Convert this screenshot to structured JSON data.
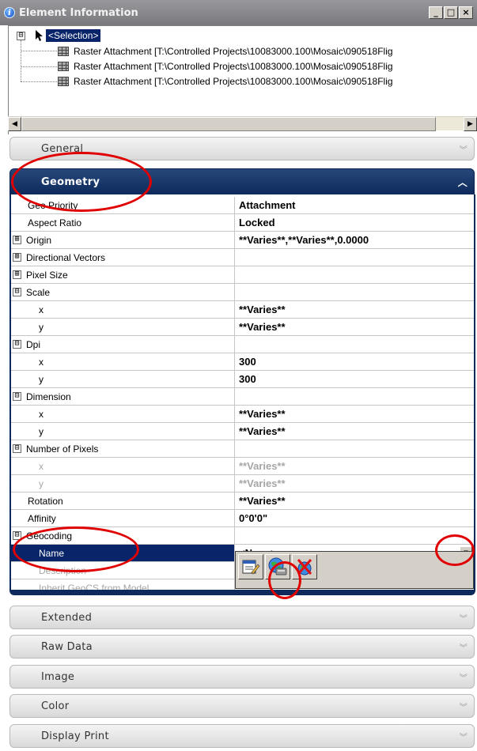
{
  "window": {
    "title": "Element Information",
    "buttons": {
      "minimize": "_",
      "maximize": "□",
      "close": "×"
    }
  },
  "tree": {
    "root": {
      "expander": "⊟",
      "label": "<Selection>"
    },
    "children": [
      {
        "label": "Raster Attachment [T:\\Controlled Projects\\10083000.100\\Mosaic\\090518Flig"
      },
      {
        "label": "Raster Attachment [T:\\Controlled Projects\\10083000.100\\Mosaic\\090518Flig"
      },
      {
        "label": "Raster Attachment [T:\\Controlled Projects\\10083000.100\\Mosaic\\090518Flig"
      }
    ],
    "scroll_left": "◀",
    "scroll_right": "▶"
  },
  "sections": {
    "general": {
      "label": "General",
      "chevron": "︾"
    },
    "geometry": {
      "label": "Geometry",
      "chevron": "︿"
    },
    "extended": {
      "label": "Extended",
      "chevron": "︾"
    },
    "raw_data": {
      "label": "Raw Data",
      "chevron": "︾"
    },
    "image": {
      "label": "Image",
      "chevron": "︾"
    },
    "color": {
      "label": "Color",
      "chevron": "︾"
    },
    "display_print": {
      "label": "Display Print",
      "chevron": "︾"
    }
  },
  "geometry_grid": {
    "rows": [
      {
        "name": "Geo Priority",
        "value": "Attachment"
      },
      {
        "name": "Aspect Ratio",
        "value": "Locked"
      },
      {
        "name": "Origin",
        "value": "**Varies**,**Varies**,0.0000",
        "expander": "⊞"
      },
      {
        "name": "Directional Vectors",
        "value": "",
        "expander": "⊞"
      },
      {
        "name": "Pixel Size",
        "value": "",
        "expander": "⊞"
      },
      {
        "name": "Scale",
        "value": "",
        "expander": "⊟"
      },
      {
        "name": "x",
        "value": "**Varies**"
      },
      {
        "name": "y",
        "value": "**Varies**"
      },
      {
        "name": "Dpi",
        "value": "",
        "expander": "⊟"
      },
      {
        "name": "x",
        "value": "300"
      },
      {
        "name": "y",
        "value": "300"
      },
      {
        "name": "Dimension",
        "value": "",
        "expander": "⊟"
      },
      {
        "name": "x",
        "value": "**Varies**"
      },
      {
        "name": "y",
        "value": "**Varies**"
      },
      {
        "name": "Number of Pixels",
        "value": "",
        "expander": "⊟"
      },
      {
        "name": "x",
        "value": "**Varies**"
      },
      {
        "name": "y",
        "value": "**Varies**"
      },
      {
        "name": "Rotation",
        "value": "**Varies**"
      },
      {
        "name": "Affinity",
        "value": "0°0'0\""
      },
      {
        "name": "Geocoding",
        "value": "",
        "expander": "⊟"
      },
      {
        "name": "Name",
        "value": "<None>"
      },
      {
        "name": "Description",
        "value": ""
      },
      {
        "name": "Inherit GeoCS from Model",
        "value": ""
      }
    ],
    "dropdown_arrow": "▼"
  },
  "colors": {
    "accent": "#0e2a5c",
    "selection": "#0a246a",
    "annotation": "#e00000"
  }
}
